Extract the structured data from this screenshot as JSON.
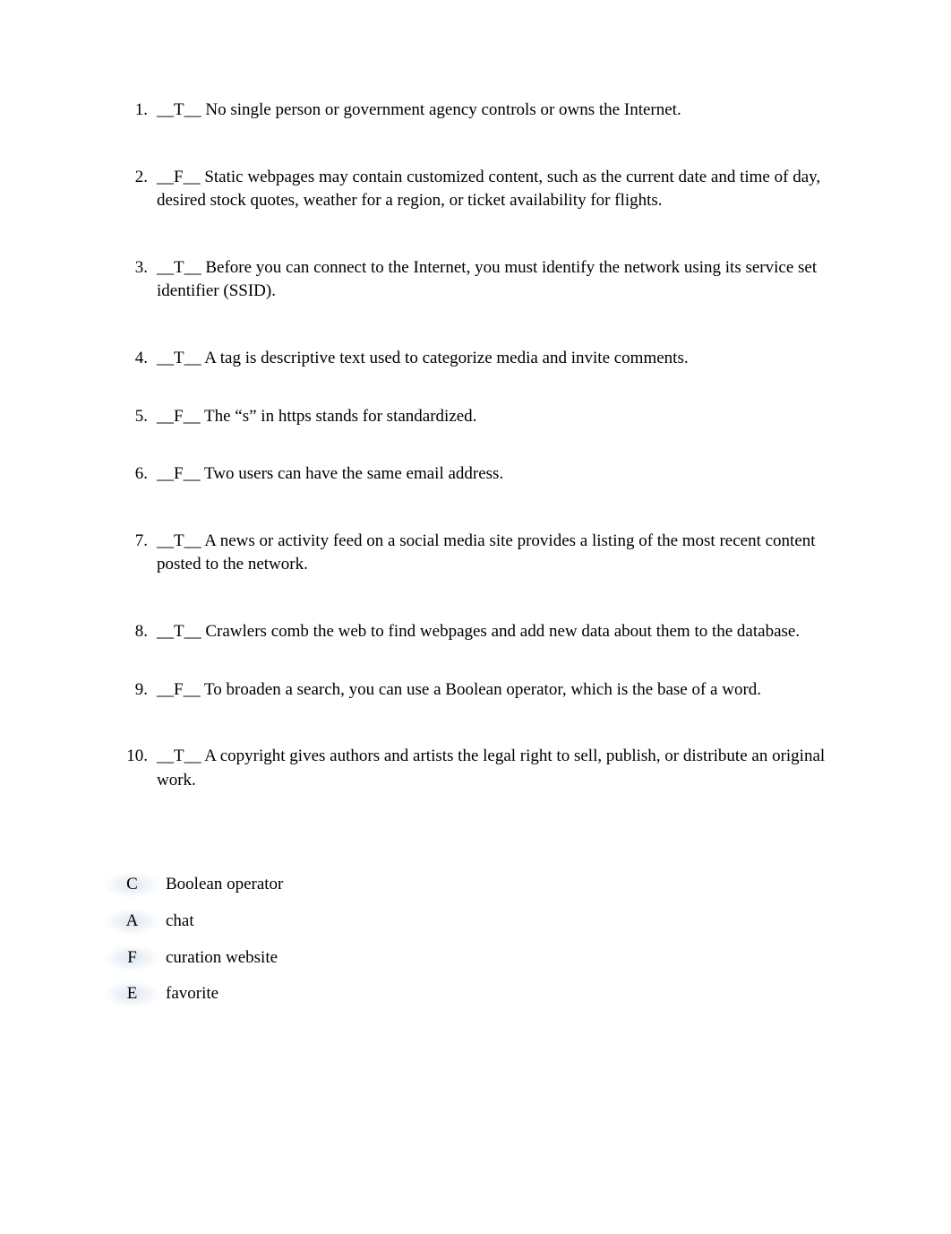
{
  "questions": [
    {
      "num": "1.",
      "answer": "__T__",
      "text": " No single person or government agency controls or owns the Internet."
    },
    {
      "num": "2.",
      "answer": "__F__",
      "text": " Static webpages may contain customized content, such as the current date and time of day, desired stock quotes, weather for a region, or ticket availability for flights."
    },
    {
      "num": "3.",
      "answer": "__T__",
      "text": " Before you can connect to the Internet, you must identify the network using its service set identifier (SSID)."
    },
    {
      "num": "4.",
      "answer": "__T__",
      "text": " A tag is descriptive text used to categorize media and invite comments."
    },
    {
      "num": "5.",
      "answer": "__F__",
      "text": " The “s” in https stands for standardized."
    },
    {
      "num": "6.",
      "answer": "__F__",
      "text": " Two users can have the same email address."
    },
    {
      "num": "7.",
      "answer": "__T__",
      "text": " A news or activity feed on a social media site provides a listing of the most recent content posted to the network."
    },
    {
      "num": "8.",
      "answer": "__T__",
      "text": " Crawlers comb the web to find webpages and add new data about them to the database."
    },
    {
      "num": "9.",
      "answer": "__F__",
      "text": " To broaden a search, you can use a Boolean operator, which is the base of a word."
    },
    {
      "num": "10.",
      "answer": "__T__",
      "text": " A copyright gives authors and artists the legal right to sell, publish, or distribute an original work."
    }
  ],
  "matching": [
    {
      "letter": "C",
      "term": "Boolean operator"
    },
    {
      "letter": "A",
      "term": "chat"
    },
    {
      "letter": "F",
      "term": "curation website"
    },
    {
      "letter": "E",
      "term": "favorite"
    }
  ]
}
